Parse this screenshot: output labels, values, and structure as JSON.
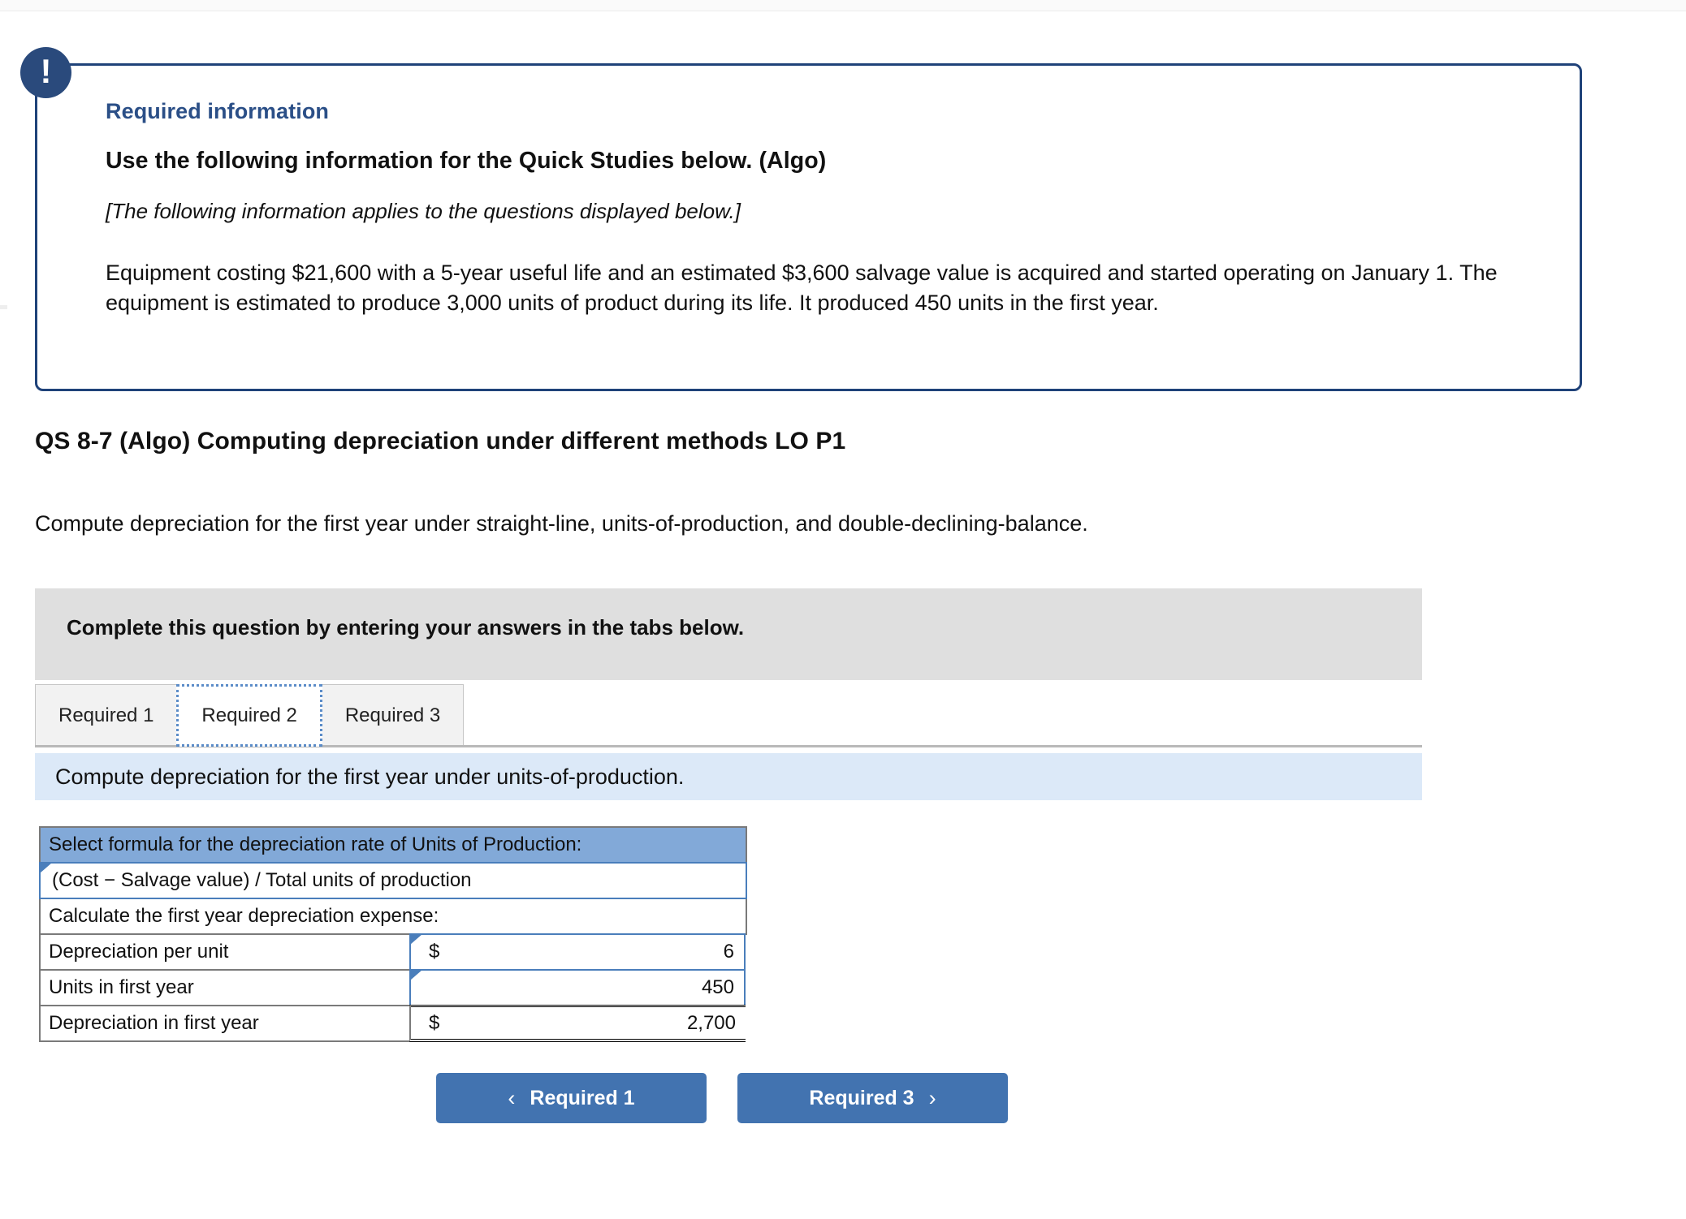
{
  "callout": {
    "icon": "exclamation-icon",
    "eyebrow": "Required information",
    "heading": "Use the following information for the Quick Studies below. (Algo)",
    "italic_note": "[The following information applies to the questions displayed below.]",
    "body": "Equipment costing $21,600 with a 5-year useful life and an estimated $3,600 salvage value is acquired and started operating on January 1. The equipment is estimated to produce 3,000 units of product during its life. It produced 450 units in the first year.",
    "border_color": "#1f4279",
    "badge_color": "#2a4a7c",
    "eyebrow_color": "#2b4f87"
  },
  "question": {
    "title": "QS 8-7 (Algo) Computing depreciation under different methods LO P1",
    "prompt": "Compute depreciation for the first year under straight-line, units-of-production, and double-declining-balance."
  },
  "complete_bar": {
    "text": "Complete this question by entering your answers in the tabs below.",
    "background": "#dfdfdf"
  },
  "tabs": [
    {
      "label": "Required 1",
      "active": false
    },
    {
      "label": "Required 2",
      "active": true
    },
    {
      "label": "Required 3",
      "active": false
    }
  ],
  "sub_instruction": {
    "text": "Compute depreciation for the first year under units-of-production.",
    "background": "#dce9f8"
  },
  "worksheet": {
    "header": "Select formula for the depreciation rate of Units of Production:",
    "header_background": "#82a9d8",
    "formula_selected": "(Cost − Salvage value) / Total units of production",
    "section_label": "Calculate the first year depreciation expense:",
    "rows": [
      {
        "label": "Depreciation per unit",
        "dollar": "$",
        "amount": "6",
        "total": false
      },
      {
        "label": "Units in first year",
        "dollar": "",
        "amount": "450",
        "total": false
      },
      {
        "label": "Depreciation in first year",
        "dollar": "$",
        "amount": "2,700",
        "total": true
      }
    ]
  },
  "nav": {
    "prev_label": "Required 1",
    "next_label": "Required 3",
    "prev_chevron": "‹",
    "next_chevron": "›",
    "button_color": "#4273b0"
  }
}
